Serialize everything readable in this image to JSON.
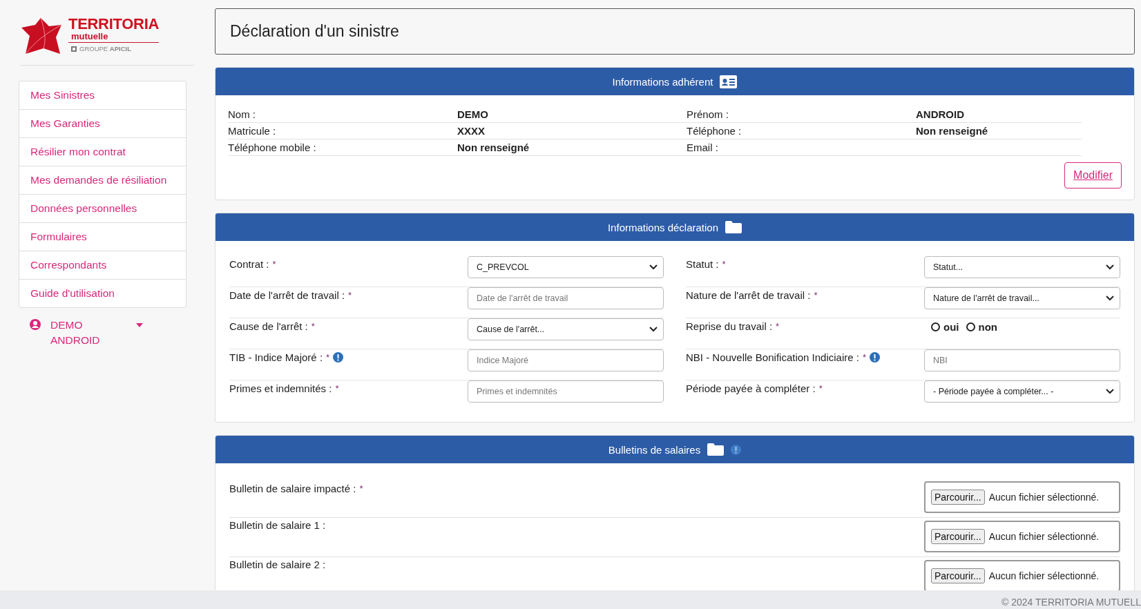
{
  "logo": {
    "name": "TERRITORIA",
    "subtitle": "mutuelle",
    "group": "GROUPE **APICIL**"
  },
  "sidebar": {
    "items": [
      {
        "label": "Mes Sinistres"
      },
      {
        "label": "Mes Garanties"
      },
      {
        "label": "Résilier mon contrat"
      },
      {
        "label": "Mes demandes de résiliation"
      },
      {
        "label": "Données personnelles"
      },
      {
        "label": "Formulaires"
      },
      {
        "label": "Correspondants"
      },
      {
        "label": "Guide d'utilisation"
      }
    ],
    "user": {
      "name": "DEMO ANDROID"
    }
  },
  "page_title": "Déclaration d'un sinistre",
  "member_card": {
    "title": "Informations adhérent",
    "rows": [
      {
        "label": "Nom :",
        "value": "DEMO",
        "label_2": "Prénom :",
        "value_2": "ANDROID"
      },
      {
        "label": "Matricule :",
        "value": "XXXX",
        "label_2": "Téléphone :",
        "value_2": "Non renseigné"
      },
      {
        "label": "Téléphone mobile :",
        "value": "Non renseigné",
        "label_2": "Email :"
      }
    ],
    "button": "Modifier"
  },
  "declaration_card": {
    "title": "Informations déclaration",
    "fields": [
      {
        "label": "Contrat :",
        "required_mark": "*",
        "kind": "select",
        "value": "C_PREVCOL"
      },
      {
        "label": "Statut :",
        "required_mark": "*",
        "kind": "select",
        "value": "Statut..."
      },
      {
        "label": "Date de l'arrêt de travail :",
        "required_mark": "*",
        "kind": "input",
        "placeholder": "Date de l'arrêt de travail"
      },
      {
        "label": "Nature de l'arrêt de travail :",
        "required_mark": "*",
        "kind": "select",
        "value": "Nature de l'arrêt de travail..."
      },
      {
        "label": "Cause de l'arrêt :",
        "required_mark": "*",
        "kind": "select",
        "value": "Cause de l'arrêt..."
      },
      {
        "label": "Reprise du travail :",
        "required_mark": "*",
        "kind": "radio",
        "options": [
          {
            "label": "oui",
            "selected": false
          },
          {
            "label": "non",
            "selected": false
          }
        ]
      },
      {
        "label": "TIB - Indice Majoré :",
        "required_mark": "*",
        "info": true,
        "kind": "input",
        "placeholder": "Indice Majoré"
      },
      {
        "label": "NBI - Nouvelle Bonification Indiciaire :",
        "required_mark": "*",
        "info": true,
        "kind": "input",
        "placeholder": "NBI"
      },
      {
        "label": "Primes et indemnités :",
        "required_mark": "*",
        "kind": "input",
        "placeholder": "Primes et indemnités"
      },
      {
        "label": "Période payée à compléter :",
        "required_mark": "*",
        "kind": "select",
        "value": "- Période payée à compléter... -"
      }
    ]
  },
  "payslips_card": {
    "title": "Bulletins de salaires",
    "info": true,
    "rows": [
      {
        "label": "Bulletin de salaire impacté :",
        "required_mark": "*",
        "button": "Parcourir...",
        "status": "Aucun fichier sélectionné."
      },
      {
        "label": "Bulletin de salaire 1 :",
        "button": "Parcourir...",
        "status": "Aucun fichier sélectionné."
      },
      {
        "label": "Bulletin de salaire 2 :",
        "button": "Parcourir...",
        "status": "Aucun fichier sélectionné."
      }
    ]
  },
  "footer": "© 2024 TERRITORIA MUTUELL"
}
